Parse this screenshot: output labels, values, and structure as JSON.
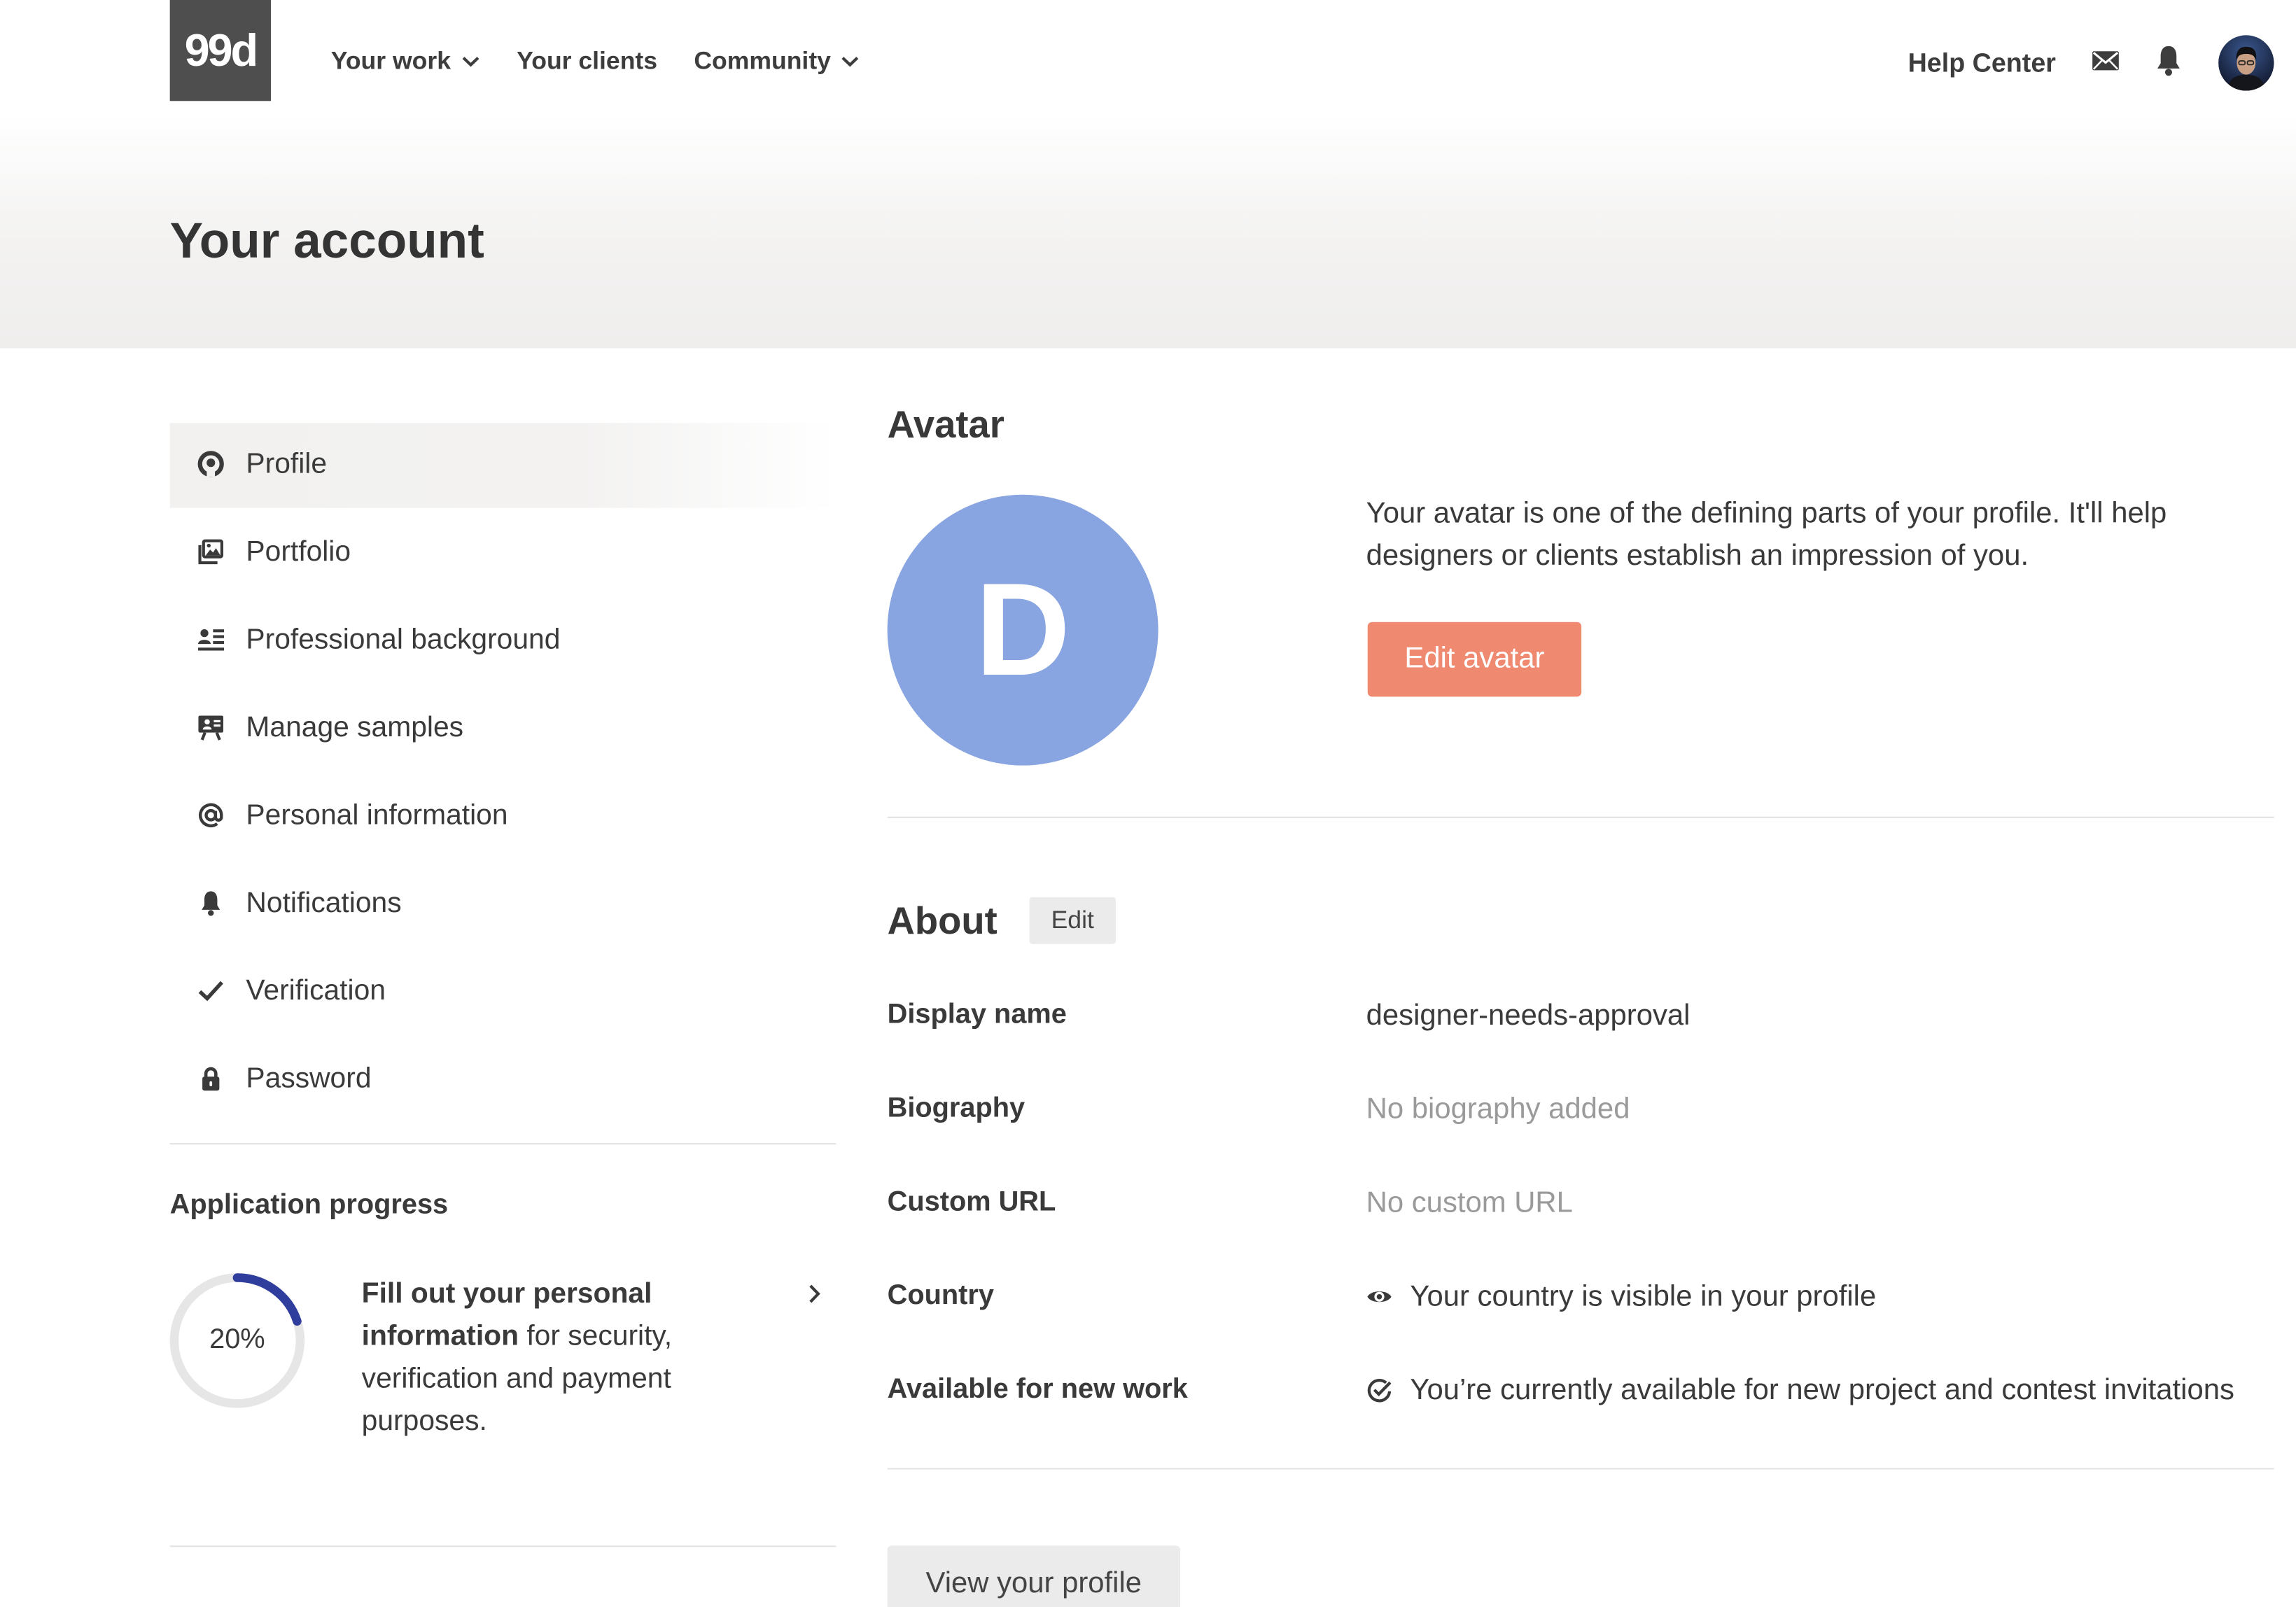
{
  "app": {
    "logo_text": "99d"
  },
  "header": {
    "nav": [
      {
        "label": "Your work",
        "has_dropdown": true
      },
      {
        "label": "Your clients",
        "has_dropdown": false
      },
      {
        "label": "Community",
        "has_dropdown": true
      }
    ],
    "help_center": "Help Center",
    "icons": [
      "mail-icon",
      "bell-icon",
      "user-avatar"
    ]
  },
  "page": {
    "title": "Your account"
  },
  "sidebar": {
    "items": [
      {
        "label": "Profile",
        "icon": "profile-icon",
        "active": true
      },
      {
        "label": "Portfolio",
        "icon": "portfolio-icon",
        "active": false
      },
      {
        "label": "Professional background",
        "icon": "professional-background-icon",
        "active": false
      },
      {
        "label": "Manage samples",
        "icon": "manage-samples-icon",
        "active": false
      },
      {
        "label": "Personal information",
        "icon": "at-sign-icon",
        "active": false
      },
      {
        "label": "Notifications",
        "icon": "bell-icon",
        "active": false
      },
      {
        "label": "Verification",
        "icon": "checkmark-icon",
        "active": false
      },
      {
        "label": "Password",
        "icon": "lock-icon",
        "active": false
      }
    ]
  },
  "application_progress": {
    "heading": "Application progress",
    "value": 20,
    "percent_label": "20%",
    "text_bold": "Fill out your personal information",
    "text_rest": " for security, verification and payment purposes."
  },
  "avatar_section": {
    "heading": "Avatar",
    "initial": "D",
    "description": "Your avatar is one of the defining parts of your profile. It'll help designers or clients establish an impression of you.",
    "edit_button": "Edit avatar"
  },
  "about": {
    "heading": "About",
    "edit_button": "Edit",
    "rows": [
      {
        "label": "Display name",
        "value": "designer-needs-approval",
        "muted": false
      },
      {
        "label": "Biography",
        "value": "No biography added",
        "muted": true
      },
      {
        "label": "Custom URL",
        "value": "No custom URL",
        "muted": true
      },
      {
        "label": "Country",
        "value": "Your country is visible in your profile",
        "icon": "eye-icon",
        "muted": false
      },
      {
        "label": "Available for new work",
        "value": "You’re currently available for new project and contest invitations",
        "icon": "check-circle-icon",
        "muted": false
      }
    ]
  },
  "view_profile_button": "View your profile",
  "colors": {
    "accent": "#ef8a71",
    "avatar_bg": "#88a4e1",
    "progress_arc": "#2f3d9c",
    "progress_track": "#e6e6e6",
    "muted_text": "#9a9a9a",
    "logo_bg": "#4e4e4e"
  }
}
